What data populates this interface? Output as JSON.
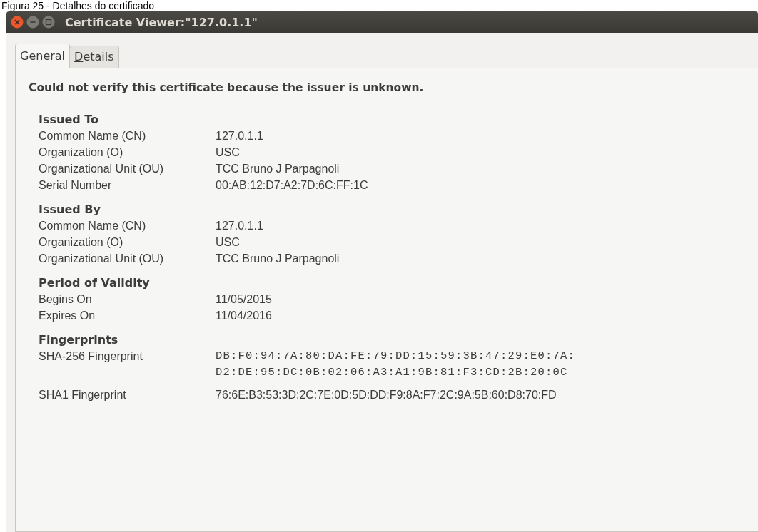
{
  "caption": "Figura 25 - Detalhes do certificado",
  "window": {
    "title": "Certificate Viewer:\"127.0.1.1\""
  },
  "tabs": [
    {
      "label": "General",
      "selected": true
    },
    {
      "label": "Details",
      "selected": false
    }
  ],
  "warning": "Could not verify this certificate because the issuer is unknown.",
  "sections": [
    {
      "title": "Issued To",
      "rows": [
        {
          "label": "Common Name (CN)",
          "kind": "text",
          "lines": [
            "127.0.1.1"
          ]
        },
        {
          "label": "Organization (O)",
          "kind": "text",
          "lines": [
            "USC"
          ]
        },
        {
          "label": "Organizational Unit (OU)",
          "kind": "text",
          "lines": [
            "TCC Bruno J Parpagnoli"
          ]
        },
        {
          "label": "Serial Number",
          "kind": "text",
          "lines": [
            "00:AB:12:D7:A2:7D:6C:FF:1C"
          ]
        }
      ]
    },
    {
      "title": "Issued By",
      "rows": [
        {
          "label": "Common Name (CN)",
          "kind": "text",
          "lines": [
            "127.0.1.1"
          ]
        },
        {
          "label": "Organization (O)",
          "kind": "text",
          "lines": [
            "USC"
          ]
        },
        {
          "label": "Organizational Unit (OU)",
          "kind": "text",
          "lines": [
            "TCC Bruno J Parpagnoli"
          ]
        }
      ]
    },
    {
      "title": "Period of Validity",
      "rows": [
        {
          "label": "Begins On",
          "kind": "text",
          "lines": [
            "11/05/2015"
          ]
        },
        {
          "label": "Expires On",
          "kind": "text",
          "lines": [
            "11/04/2016"
          ]
        }
      ]
    },
    {
      "title": "Fingerprints",
      "rows": [
        {
          "label": "SHA-256 Fingerprint",
          "kind": "mono",
          "lines": [
            "DB:F0:94:7A:80:DA:FE:79:DD:15:59:3B:47:29:E0:7A:",
            "D2:DE:95:DC:0B:02:06:A3:A1:9B:81:F3:CD:2B:20:0C"
          ]
        },
        {
          "label": "SHA1 Fingerprint",
          "kind": "text",
          "lines": [
            "76:6E:B3:53:3D:2C:7E:0D:5D:DD:F9:8A:F7:2C:9A:5B:60:D8:70:FD"
          ]
        }
      ]
    }
  ]
}
